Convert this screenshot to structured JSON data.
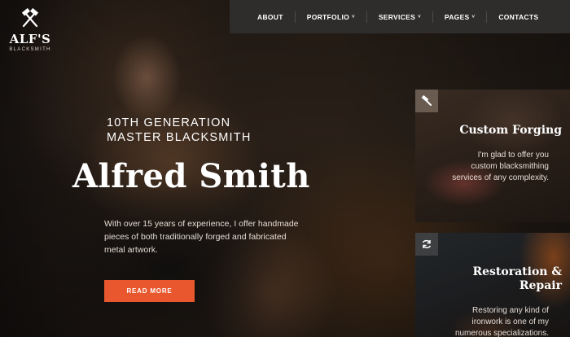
{
  "logo": {
    "name": "ALF'S",
    "subtitle": "BLACKSMITH",
    "icon": "crossed-hammers-icon"
  },
  "nav": {
    "items": [
      {
        "label": "ABOUT",
        "has_dropdown": false
      },
      {
        "label": "PORTFOLIO",
        "has_dropdown": true
      },
      {
        "label": "SERVICES",
        "has_dropdown": true
      },
      {
        "label": "PAGES",
        "has_dropdown": true
      },
      {
        "label": "CONTACTS",
        "has_dropdown": false
      }
    ],
    "chevron": "˅"
  },
  "hero": {
    "tagline_line1": "10TH GENERATION",
    "tagline_line2": "MASTER BLACKSMITH",
    "title": "Alfred Smith",
    "description": "With over 15 years of experience, I offer handmade pieces of both traditionally forged and fabricated metal artwork.",
    "cta_label": "READ MORE"
  },
  "services": [
    {
      "icon": "hammer-icon",
      "title": "Custom Forging",
      "text": "I'm glad to offer you custom blacksmithing services of any complexity."
    },
    {
      "icon": "refresh-icon",
      "title": "Restoration & Repair",
      "text": "Restoring any kind of ironwork is one of my numerous specializations."
    }
  ],
  "colors": {
    "accent": "#e9572e",
    "nav_bg": "#2e2d2c"
  }
}
